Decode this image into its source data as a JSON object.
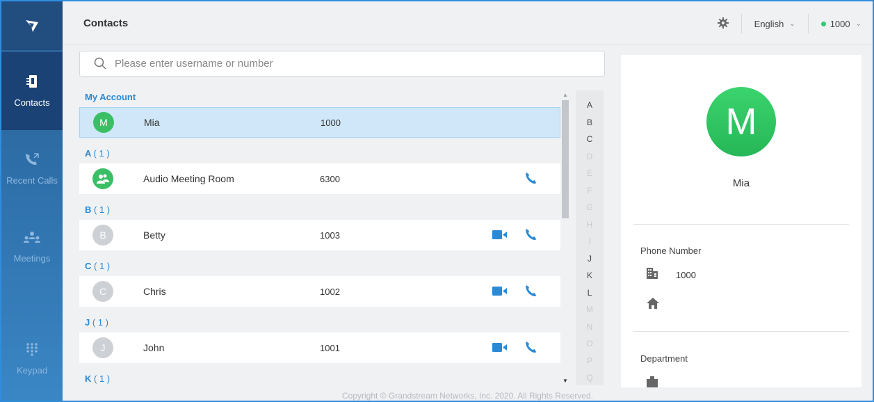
{
  "sidebar": {
    "items": [
      {
        "label": "Contacts",
        "icon": "contacts-icon",
        "active": true
      },
      {
        "label": "Recent Calls",
        "icon": "recent-calls-icon",
        "active": false
      },
      {
        "label": "Meetings",
        "icon": "meetings-icon",
        "active": false
      },
      {
        "label": "Keypad",
        "icon": "keypad-icon",
        "active": false
      }
    ]
  },
  "header": {
    "title": "Contacts",
    "language": "English",
    "account": "1000"
  },
  "search": {
    "placeholder": "Please enter username or number"
  },
  "list": {
    "my_account_label": "My Account",
    "my_account": {
      "initial": "M",
      "name": "Mia",
      "number": "1000"
    },
    "groups": [
      {
        "letter": "A",
        "count": "( 1 )",
        "contacts": [
          {
            "initial": "",
            "name": "Audio Meeting Room",
            "number": "6300",
            "video": false
          }
        ]
      },
      {
        "letter": "B",
        "count": "( 1 )",
        "contacts": [
          {
            "initial": "B",
            "name": "Betty",
            "number": "1003",
            "video": true
          }
        ]
      },
      {
        "letter": "C",
        "count": "( 1 )",
        "contacts": [
          {
            "initial": "C",
            "name": "Chris",
            "number": "1002",
            "video": true
          }
        ]
      },
      {
        "letter": "J",
        "count": "( 1 )",
        "contacts": [
          {
            "initial": "J",
            "name": "John",
            "number": "1001",
            "video": true
          }
        ]
      },
      {
        "letter": "K",
        "count": "( 1 )",
        "contacts": []
      }
    ]
  },
  "alphabet": [
    {
      "l": "A",
      "on": true
    },
    {
      "l": "B",
      "on": true
    },
    {
      "l": "C",
      "on": true
    },
    {
      "l": "D",
      "on": false
    },
    {
      "l": "E",
      "on": false
    },
    {
      "l": "F",
      "on": false
    },
    {
      "l": "G",
      "on": false
    },
    {
      "l": "H",
      "on": false
    },
    {
      "l": "I",
      "on": false
    },
    {
      "l": "J",
      "on": true
    },
    {
      "l": "K",
      "on": true
    },
    {
      "l": "L",
      "on": true
    },
    {
      "l": "M",
      "on": false
    },
    {
      "l": "N",
      "on": false
    },
    {
      "l": "O",
      "on": false
    },
    {
      "l": "P",
      "on": false
    },
    {
      "l": "Q",
      "on": false
    }
  ],
  "detail": {
    "initial": "M",
    "name": "Mia",
    "phone_label": "Phone Number",
    "work_number": "1000",
    "department_label": "Department"
  },
  "footer": "Copyright © Grandstream Networks, Inc. 2020. All Rights Reserved.",
  "colors": {
    "accent": "#2a8ad6",
    "green": "#3bbf66",
    "selected_row": "#cfe7f8"
  }
}
